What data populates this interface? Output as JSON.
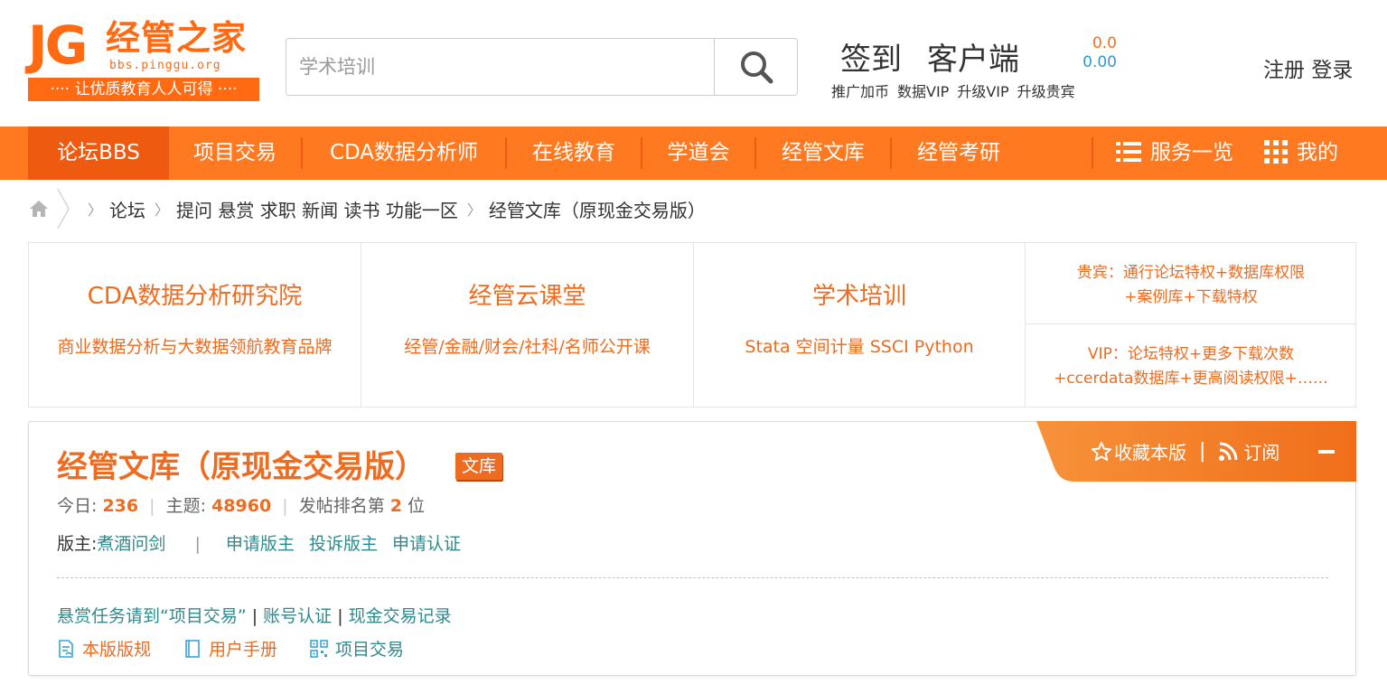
{
  "logo": {
    "letters": "JG",
    "name": "经管之家",
    "url": "bbs.pinggu.org",
    "slogan": "···· 让优质教育人人可得 ····"
  },
  "search": {
    "placeholder": "学术培训"
  },
  "header": {
    "checkin": "签到",
    "client": "客户端",
    "sub_links": [
      "推广加币",
      "数据VIP",
      "升级VIP",
      "升级贵宾"
    ],
    "balance_1": "0.0",
    "balance_2": "0.00",
    "register": "注册",
    "login": "登录"
  },
  "nav": {
    "items": [
      "论坛BBS",
      "项目交易",
      "CDA数据分析师",
      "在线教育",
      "学道会",
      "经管文库",
      "经管考研"
    ],
    "services": "服务一览",
    "mine": "我的"
  },
  "breadcrumb": {
    "items": [
      "论坛",
      "提问 悬赏 求职 新闻 读书 功能一区",
      "经管文库（原现金交易版）"
    ]
  },
  "promo": {
    "cells": [
      {
        "title": "CDA数据分析研究院",
        "sub": "商业数据分析与大数据领航教育品牌"
      },
      {
        "title": "经管云课堂",
        "sub": "经管/金融/财会/社科/名师公开课"
      },
      {
        "title": "学术培训",
        "sub": "Stata 空间计量 SSCI Python"
      }
    ],
    "vip_line1": "贵宾：通行论坛特权+数据库权限",
    "vip_line2": "+案例库+下载特权",
    "vip2_line1": "VIP：论坛特权+更多下载次数",
    "vip2_line2": "+ccerdata数据库+更高阅读权限+……"
  },
  "forum": {
    "title": "经管文库（原现金交易版）",
    "tag": "文库",
    "favorite": "收藏本版",
    "subscribe": "订阅",
    "today_label": "今日:",
    "today": "236",
    "topics_label": "主题:",
    "topics": "48960",
    "rank_prefix": "发帖排名第",
    "rank": "2",
    "rank_suffix": "位",
    "mod_label": "版主:",
    "moderator": "煮酒问剑",
    "mod_links": [
      "申请版主",
      "投诉版主",
      "申请认证"
    ],
    "notice_1": "悬赏任务请到“项目交易”",
    "notice_2": "账号认证",
    "notice_3": "现金交易记录",
    "tools": [
      "本版版规",
      "用户手册",
      "项目交易"
    ]
  },
  "colors": {
    "brand_orange": "#ff7920",
    "nav_active": "#ee5a10",
    "text_orange": "#ee6b1f",
    "link_teal": "#2f8a8c"
  }
}
